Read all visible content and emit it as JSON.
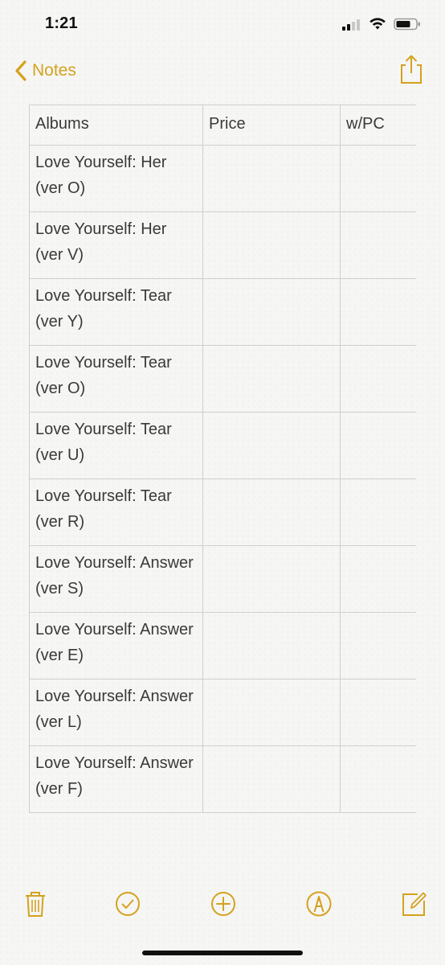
{
  "status_bar": {
    "time": "1:21"
  },
  "nav": {
    "back_label": "Notes",
    "accent_color": "#d4a21f"
  },
  "table": {
    "headers": [
      "Albums",
      "Price",
      "w/PC"
    ],
    "rows": [
      [
        "Love Yourself: Her (ver O)",
        "",
        ""
      ],
      [
        "Love Yourself: Her (ver V)",
        "",
        ""
      ],
      [
        "Love Yourself: Tear (ver Y)",
        "",
        ""
      ],
      [
        "Love Yourself: Tear (ver O)",
        "",
        ""
      ],
      [
        "Love Yourself: Tear (ver U)",
        "",
        ""
      ],
      [
        "Love Yourself: Tear (ver R)",
        "",
        ""
      ],
      [
        "Love Yourself: Answer (ver S)",
        "",
        ""
      ],
      [
        "Love Yourself: Answer (ver E)",
        "",
        ""
      ],
      [
        "Love Yourself: Answer (ver L)",
        "",
        ""
      ],
      [
        "Love Yourself: Answer (ver F)",
        "",
        ""
      ]
    ]
  },
  "toolbar": {
    "icons": [
      "trash-icon",
      "checklist-icon",
      "add-icon",
      "markup-icon",
      "compose-icon"
    ]
  }
}
